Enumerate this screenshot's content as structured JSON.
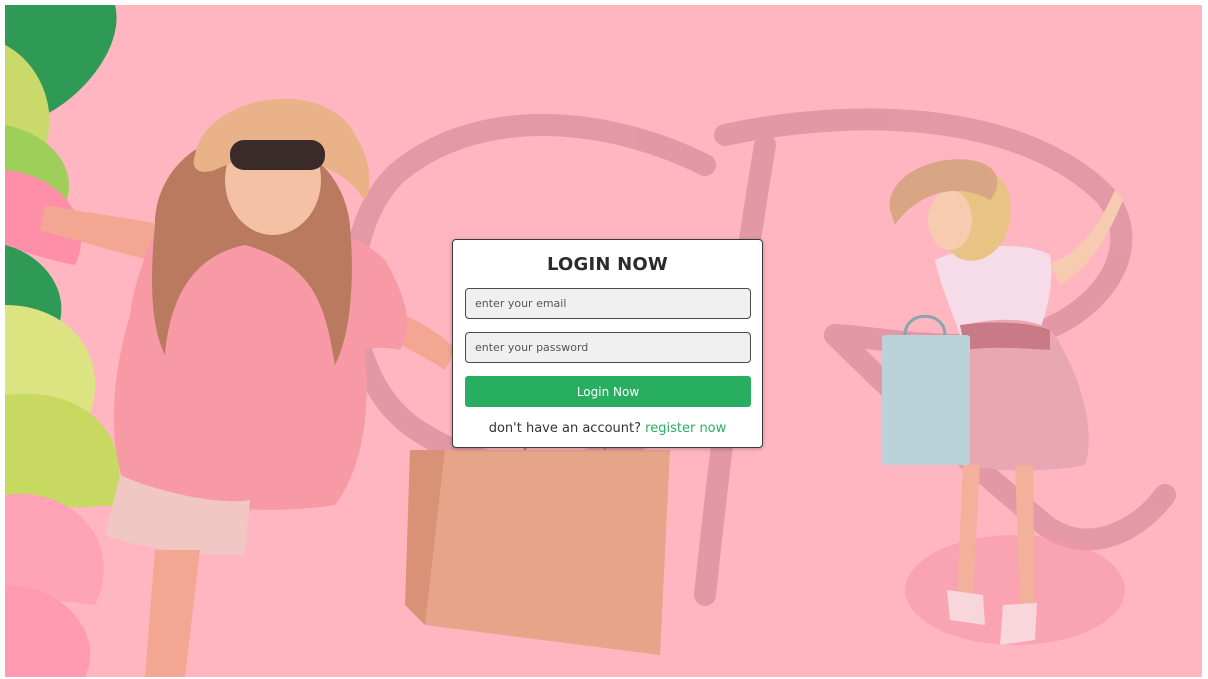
{
  "login": {
    "title": "LOGIN NOW",
    "email_placeholder": "enter your email",
    "password_placeholder": "enter your password",
    "submit_label": "Login Now",
    "register_prompt": "don't have an account?",
    "register_link": "register now"
  },
  "colors": {
    "background": "#ffb6c1",
    "accent": "#27ae60",
    "card": "#ffffff"
  }
}
